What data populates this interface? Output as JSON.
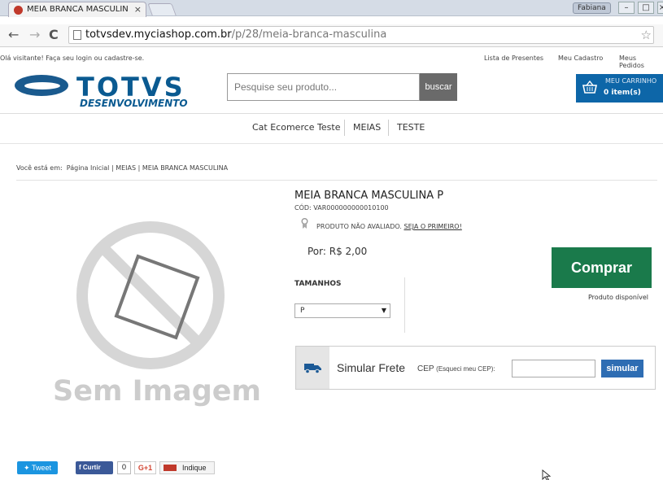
{
  "browser": {
    "tab_title": "MEIA BRANCA MASCULIN",
    "tab_close": "×",
    "user_chip": "Fabiana",
    "url_host": "totvsdev.myciashop.com.br",
    "url_path": "/p/28/meia-branca-masculina"
  },
  "topbar": {
    "welcome": "Olá visitante! Faça seu login ou cadastre-se.",
    "links": [
      "Lista de Presentes",
      "Meu Cadastro",
      "Meus Pedidos"
    ]
  },
  "logo": {
    "word": "TOTVS",
    "sub": "DESENVOLVIMENTO"
  },
  "search": {
    "placeholder": "Pesquise seu produto...",
    "button": "buscar"
  },
  "cart": {
    "title": "MEU CARRINHO",
    "count": "0 item(s)"
  },
  "categories": [
    "Cat Ecomerce Teste",
    "MEIAS",
    "TESTE"
  ],
  "breadcrumb": {
    "prefix": "Você está em:",
    "items": [
      "Página Inicial",
      "MEIAS",
      "MEIA BRANCA MASCULINA"
    ],
    "separator": "|"
  },
  "no_image_text": "Sem Imagem",
  "product": {
    "title": "MEIA BRANCA MASCULINA P",
    "code": "CÓD: VAR000000000010100",
    "rating_text": "PRODUTO NÃO AVALIADO.",
    "rating_link": "SEJA O PRIMEIRO!",
    "price": "Por: R$ 2,00",
    "buy": "Comprar",
    "stock": "Produto disponível",
    "size_label": "TAMANHOS",
    "size_selected": "P"
  },
  "frete": {
    "title": "Simular Frete",
    "cep_label": "CEP",
    "cep_hint": "(Esqueci meu CEP):",
    "button": "simular"
  },
  "social": {
    "tweet": "Tweet",
    "fb": "Curtir",
    "fb_count": "0",
    "gplus": "G+1",
    "indique": "Indique"
  },
  "colors": {
    "brand_blue": "#0a5a91",
    "cart_blue": "#0d66a8",
    "buy_green": "#1a7a4b",
    "simulate_blue": "#2e6db3"
  }
}
